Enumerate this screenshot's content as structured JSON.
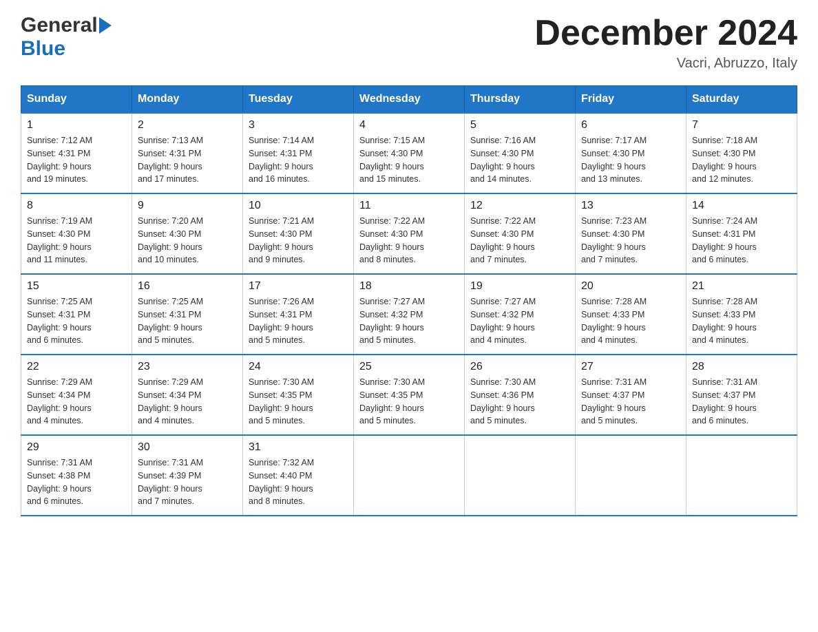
{
  "header": {
    "logo_general": "General",
    "logo_blue": "Blue",
    "month_title": "December 2024",
    "location": "Vacri, Abruzzo, Italy"
  },
  "calendar": {
    "days_of_week": [
      "Sunday",
      "Monday",
      "Tuesday",
      "Wednesday",
      "Thursday",
      "Friday",
      "Saturday"
    ],
    "weeks": [
      [
        {
          "day": "1",
          "sunrise": "7:12 AM",
          "sunset": "4:31 PM",
          "daylight": "9 hours and 19 minutes."
        },
        {
          "day": "2",
          "sunrise": "7:13 AM",
          "sunset": "4:31 PM",
          "daylight": "9 hours and 17 minutes."
        },
        {
          "day": "3",
          "sunrise": "7:14 AM",
          "sunset": "4:31 PM",
          "daylight": "9 hours and 16 minutes."
        },
        {
          "day": "4",
          "sunrise": "7:15 AM",
          "sunset": "4:30 PM",
          "daylight": "9 hours and 15 minutes."
        },
        {
          "day": "5",
          "sunrise": "7:16 AM",
          "sunset": "4:30 PM",
          "daylight": "9 hours and 14 minutes."
        },
        {
          "day": "6",
          "sunrise": "7:17 AM",
          "sunset": "4:30 PM",
          "daylight": "9 hours and 13 minutes."
        },
        {
          "day": "7",
          "sunrise": "7:18 AM",
          "sunset": "4:30 PM",
          "daylight": "9 hours and 12 minutes."
        }
      ],
      [
        {
          "day": "8",
          "sunrise": "7:19 AM",
          "sunset": "4:30 PM",
          "daylight": "9 hours and 11 minutes."
        },
        {
          "day": "9",
          "sunrise": "7:20 AM",
          "sunset": "4:30 PM",
          "daylight": "9 hours and 10 minutes."
        },
        {
          "day": "10",
          "sunrise": "7:21 AM",
          "sunset": "4:30 PM",
          "daylight": "9 hours and 9 minutes."
        },
        {
          "day": "11",
          "sunrise": "7:22 AM",
          "sunset": "4:30 PM",
          "daylight": "9 hours and 8 minutes."
        },
        {
          "day": "12",
          "sunrise": "7:22 AM",
          "sunset": "4:30 PM",
          "daylight": "9 hours and 7 minutes."
        },
        {
          "day": "13",
          "sunrise": "7:23 AM",
          "sunset": "4:30 PM",
          "daylight": "9 hours and 7 minutes."
        },
        {
          "day": "14",
          "sunrise": "7:24 AM",
          "sunset": "4:31 PM",
          "daylight": "9 hours and 6 minutes."
        }
      ],
      [
        {
          "day": "15",
          "sunrise": "7:25 AM",
          "sunset": "4:31 PM",
          "daylight": "9 hours and 6 minutes."
        },
        {
          "day": "16",
          "sunrise": "7:25 AM",
          "sunset": "4:31 PM",
          "daylight": "9 hours and 5 minutes."
        },
        {
          "day": "17",
          "sunrise": "7:26 AM",
          "sunset": "4:31 PM",
          "daylight": "9 hours and 5 minutes."
        },
        {
          "day": "18",
          "sunrise": "7:27 AM",
          "sunset": "4:32 PM",
          "daylight": "9 hours and 5 minutes."
        },
        {
          "day": "19",
          "sunrise": "7:27 AM",
          "sunset": "4:32 PM",
          "daylight": "9 hours and 4 minutes."
        },
        {
          "day": "20",
          "sunrise": "7:28 AM",
          "sunset": "4:33 PM",
          "daylight": "9 hours and 4 minutes."
        },
        {
          "day": "21",
          "sunrise": "7:28 AM",
          "sunset": "4:33 PM",
          "daylight": "9 hours and 4 minutes."
        }
      ],
      [
        {
          "day": "22",
          "sunrise": "7:29 AM",
          "sunset": "4:34 PM",
          "daylight": "9 hours and 4 minutes."
        },
        {
          "day": "23",
          "sunrise": "7:29 AM",
          "sunset": "4:34 PM",
          "daylight": "9 hours and 4 minutes."
        },
        {
          "day": "24",
          "sunrise": "7:30 AM",
          "sunset": "4:35 PM",
          "daylight": "9 hours and 5 minutes."
        },
        {
          "day": "25",
          "sunrise": "7:30 AM",
          "sunset": "4:35 PM",
          "daylight": "9 hours and 5 minutes."
        },
        {
          "day": "26",
          "sunrise": "7:30 AM",
          "sunset": "4:36 PM",
          "daylight": "9 hours and 5 minutes."
        },
        {
          "day": "27",
          "sunrise": "7:31 AM",
          "sunset": "4:37 PM",
          "daylight": "9 hours and 5 minutes."
        },
        {
          "day": "28",
          "sunrise": "7:31 AM",
          "sunset": "4:37 PM",
          "daylight": "9 hours and 6 minutes."
        }
      ],
      [
        {
          "day": "29",
          "sunrise": "7:31 AM",
          "sunset": "4:38 PM",
          "daylight": "9 hours and 6 minutes."
        },
        {
          "day": "30",
          "sunrise": "7:31 AM",
          "sunset": "4:39 PM",
          "daylight": "9 hours and 7 minutes."
        },
        {
          "day": "31",
          "sunrise": "7:32 AM",
          "sunset": "4:40 PM",
          "daylight": "9 hours and 8 minutes."
        },
        null,
        null,
        null,
        null
      ]
    ],
    "labels": {
      "sunrise": "Sunrise:",
      "sunset": "Sunset:",
      "daylight": "Daylight:"
    }
  }
}
